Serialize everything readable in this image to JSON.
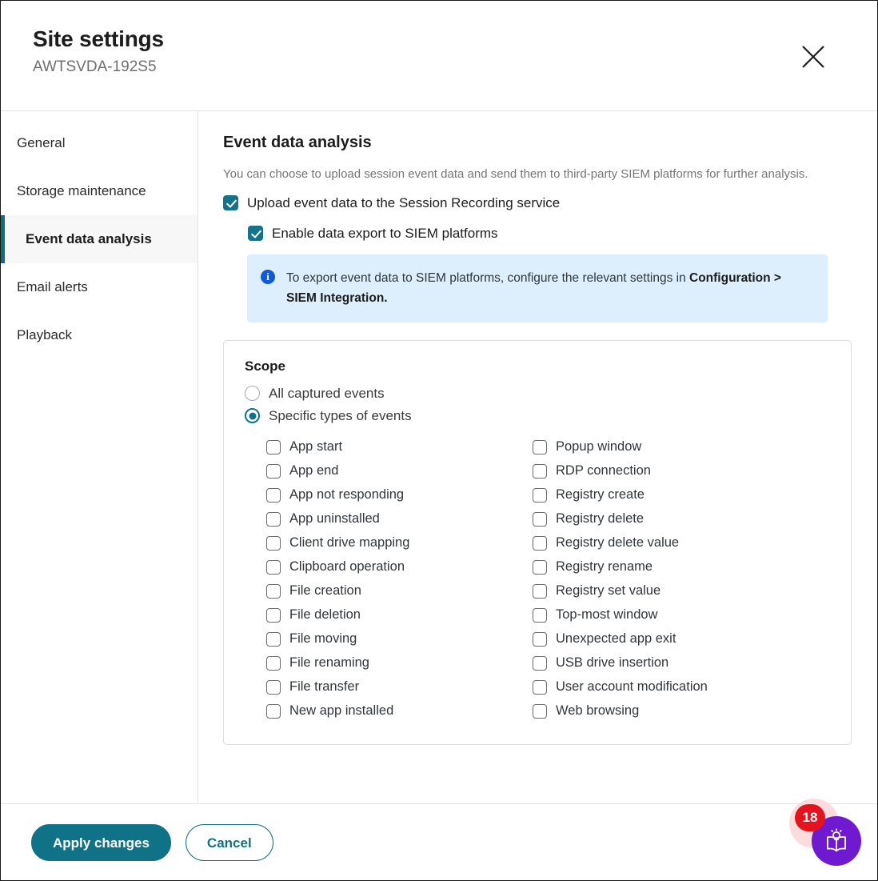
{
  "window": {
    "title": "Site settings",
    "subtitle": "AWTSVDA-192S5",
    "close_icon": "close-icon"
  },
  "sidebar": {
    "items": [
      {
        "label": "General",
        "active": false
      },
      {
        "label": "Storage maintenance",
        "active": false
      },
      {
        "label": "Event data analysis",
        "active": true
      },
      {
        "label": "Email alerts",
        "active": false
      },
      {
        "label": "Playback",
        "active": false
      }
    ]
  },
  "main": {
    "title": "Event data analysis",
    "description": "You can choose to upload session event data and send them to third-party SIEM platforms for further analysis.",
    "upload_checkbox": {
      "label": "Upload event data to the Session Recording service",
      "checked": true
    },
    "siem_checkbox": {
      "label": "Enable data export to SIEM platforms",
      "checked": true
    },
    "info_banner": {
      "icon": "info-icon",
      "text_before": "To export event data to SIEM platforms, configure the relevant settings in ",
      "text_bold": "Configuration > SIEM Integration."
    },
    "scope": {
      "title": "Scope",
      "options": [
        {
          "label": "All captured events",
          "selected": false
        },
        {
          "label": "Specific types of events",
          "selected": true
        }
      ],
      "events_left": [
        {
          "label": "App start",
          "checked": false
        },
        {
          "label": "App end",
          "checked": false
        },
        {
          "label": "App not responding",
          "checked": false
        },
        {
          "label": "App uninstalled",
          "checked": false
        },
        {
          "label": "Client drive mapping",
          "checked": false
        },
        {
          "label": "Clipboard operation",
          "checked": false
        },
        {
          "label": "File creation",
          "checked": false
        },
        {
          "label": "File deletion",
          "checked": false
        },
        {
          "label": "File moving",
          "checked": false
        },
        {
          "label": "File renaming",
          "checked": false
        },
        {
          "label": "File transfer",
          "checked": false
        },
        {
          "label": "New app installed",
          "checked": false
        }
      ],
      "events_right": [
        {
          "label": "Popup window",
          "checked": false
        },
        {
          "label": "RDP connection",
          "checked": false
        },
        {
          "label": "Registry create",
          "checked": false
        },
        {
          "label": "Registry delete",
          "checked": false
        },
        {
          "label": "Registry delete value",
          "checked": false
        },
        {
          "label": "Registry rename",
          "checked": false
        },
        {
          "label": "Registry set value",
          "checked": false
        },
        {
          "label": "Top-most window",
          "checked": false
        },
        {
          "label": "Unexpected app exit",
          "checked": false
        },
        {
          "label": "USB drive insertion",
          "checked": false
        },
        {
          "label": "User account modification",
          "checked": false
        },
        {
          "label": "Web browsing",
          "checked": false
        }
      ]
    }
  },
  "footer": {
    "apply_label": "Apply changes",
    "cancel_label": "Cancel"
  },
  "help_widget": {
    "badge_count": "18",
    "icon": "book-lightbulb-icon"
  },
  "colors": {
    "accent_teal": "#0f7286",
    "checkbox_teal": "#14728a",
    "info_blue": "#1059d8",
    "info_bg": "#ddeffc",
    "badge_red": "#e4141e",
    "fab_purple": "#6f1ad0",
    "halo_pink": "#fbdcdc"
  }
}
